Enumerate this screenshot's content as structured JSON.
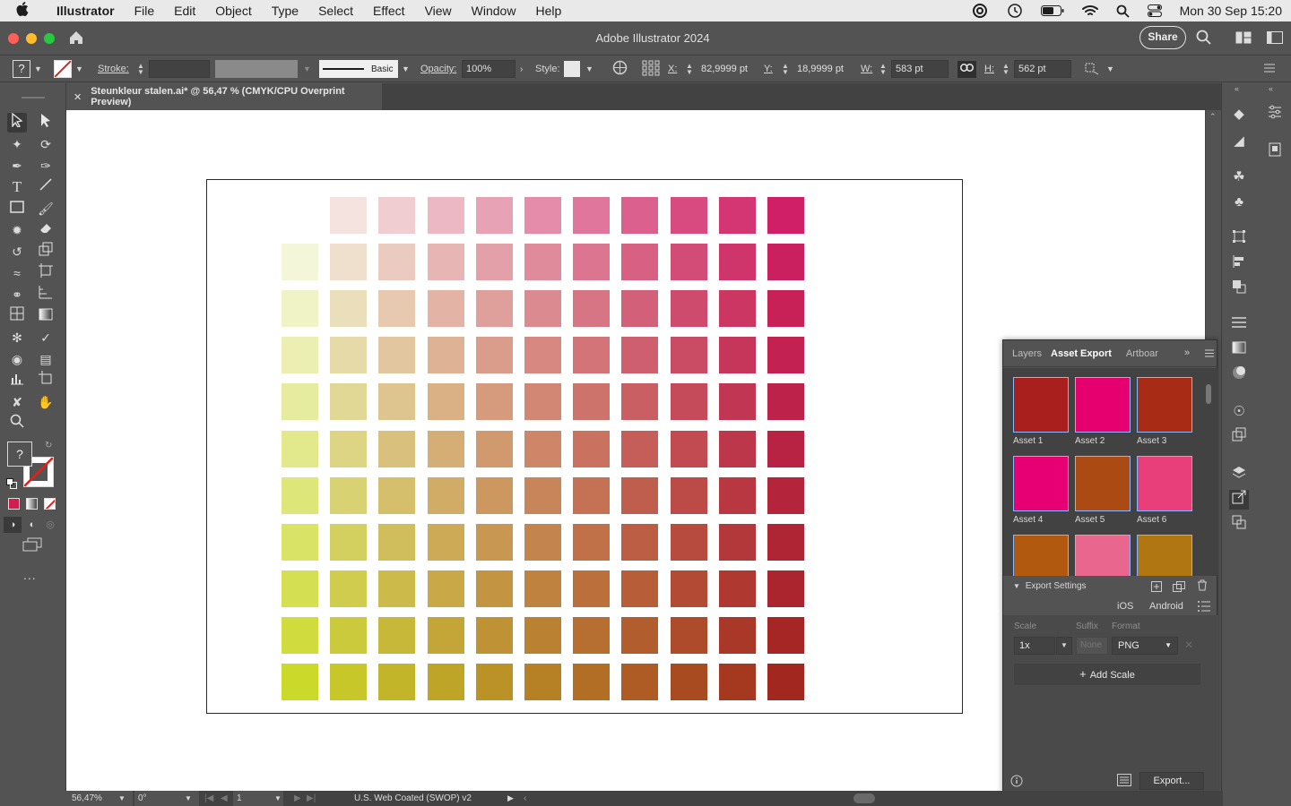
{
  "menubar": {
    "app_name": "Illustrator",
    "items": [
      "File",
      "Edit",
      "Object",
      "Type",
      "Select",
      "Effect",
      "View",
      "Window",
      "Help"
    ],
    "clock": "Mon 30 Sep  15:20"
  },
  "titlebar": {
    "title": "Adobe Illustrator 2024",
    "share_label": "Share"
  },
  "controlbar": {
    "fill_unknown": "?",
    "stroke_label": "Stroke:",
    "brush_label": "Basic",
    "opacity_label": "Opacity:",
    "opacity_value": "100%",
    "style_label": "Style:",
    "x_label": "X:",
    "x_value": "82,9999 pt",
    "y_label": "Y:",
    "y_value": "18,9999 pt",
    "w_label": "W:",
    "w_value": "583 pt",
    "h_label": "H:",
    "h_value": "562 pt"
  },
  "document": {
    "tab_title": "Steunkleur stalen.ai* @ 56,47 % (CMYK/CPU Overprint Preview)"
  },
  "toolbar": {
    "fill_unknown": "?",
    "more": "..."
  },
  "panel": {
    "tabs": [
      "Layers",
      "Asset Export",
      "Artboar"
    ],
    "assets": [
      {
        "label": "Asset 1",
        "color": "#a81f1e"
      },
      {
        "label": "Asset 2",
        "color": "#e6006f"
      },
      {
        "label": "Asset 3",
        "color": "#a82b15"
      },
      {
        "label": "Asset 4",
        "color": "#e60073"
      },
      {
        "label": "Asset 5",
        "color": "#ab4a13"
      },
      {
        "label": "Asset 6",
        "color": "#e83e79"
      },
      {
        "label": "",
        "color": "#b0590f"
      },
      {
        "label": "",
        "color": "#e9678f"
      },
      {
        "label": "",
        "color": "#b07612"
      }
    ],
    "export_settings_label": "Export Settings",
    "ios_label": "iOS",
    "android_label": "Android",
    "scale_header": "Scale",
    "suffix_header": "Suffix",
    "format_header": "Format",
    "scale_value": "1x",
    "suffix_placeholder": "None",
    "format_value": "PNG",
    "add_scale_label": "Add Scale",
    "export_button_label": "Export..."
  },
  "statusbar": {
    "zoom": "56,47%",
    "rotation": "0°",
    "artboard_number": "1",
    "color_profile": "U.S. Web Coated (SWOP) v2"
  },
  "swatch_grid": {
    "colors": {
      "top_left": "#f8f9ec",
      "top_right": "#d01f66",
      "bottom_left": "#cbd92b",
      "bottom_right": "#a1271f"
    },
    "rows": 11,
    "cols": 11,
    "empty_cells": [
      [
        0,
        0
      ]
    ]
  }
}
